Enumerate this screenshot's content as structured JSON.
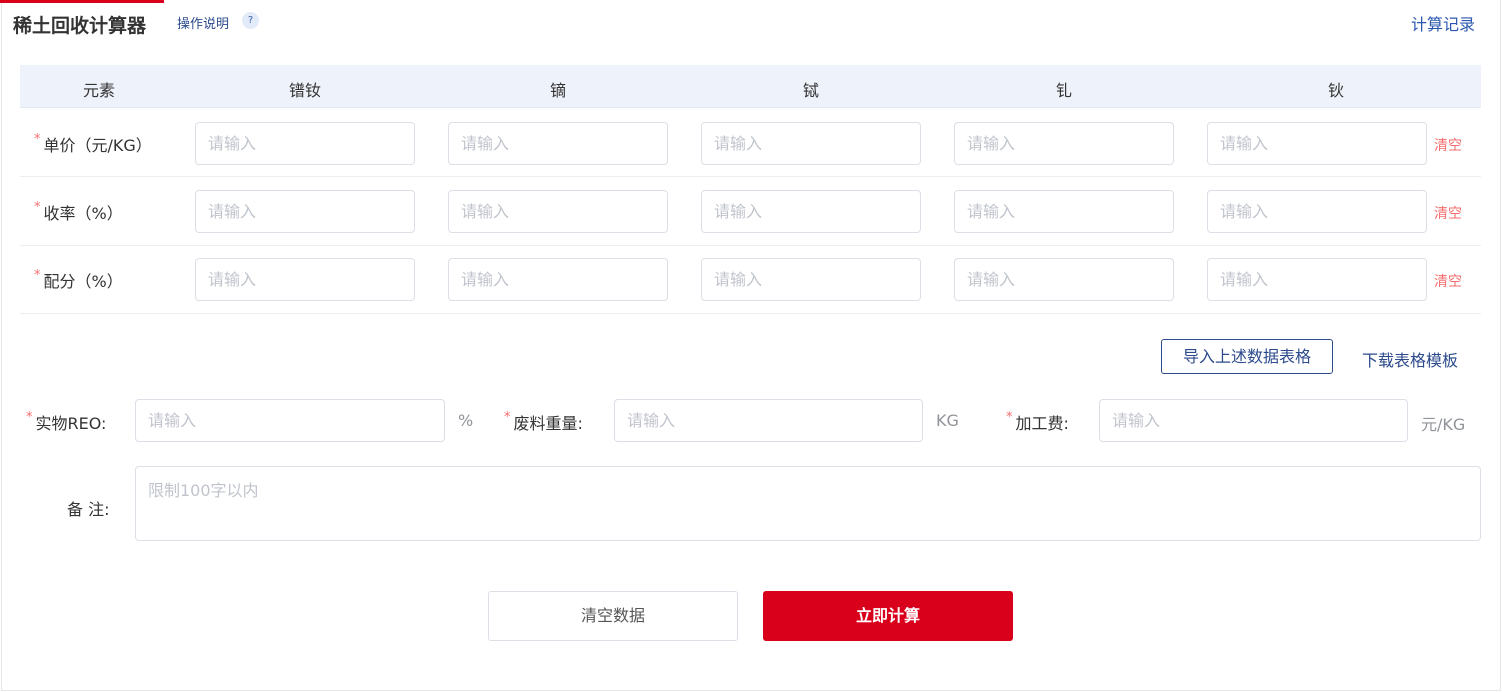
{
  "header": {
    "title": "稀土回收计算器",
    "help": "操作说明",
    "help_icon": "?",
    "history": "计算记录"
  },
  "table": {
    "columns": [
      "元素",
      "镨钕",
      "镝",
      "铽",
      "钆",
      "钬"
    ],
    "placeholder": "请输入",
    "clear_label": "清空",
    "rows": [
      {
        "label": "单价（元/KG）"
      },
      {
        "label": "收率（%）"
      },
      {
        "label": "配分（%）"
      }
    ]
  },
  "actions": {
    "import": "导入上述数据表格",
    "download": "下载表格模板"
  },
  "form": {
    "required_mark": "*",
    "reo_label": "实物REO:",
    "reo_unit": "%",
    "weight_label": "废料重量:",
    "weight_unit": "KG",
    "fee_label": "加工费:",
    "fee_unit": "元/KG",
    "placeholder": "请输入",
    "remark_label": "备 注:",
    "remark_placeholder": "限制100字以内"
  },
  "buttons": {
    "clear": "清空数据",
    "calculate": "立即计算"
  },
  "colors": {
    "accent": "#d9001b",
    "link": "#2c4a8c",
    "danger": "#f56c6c"
  }
}
